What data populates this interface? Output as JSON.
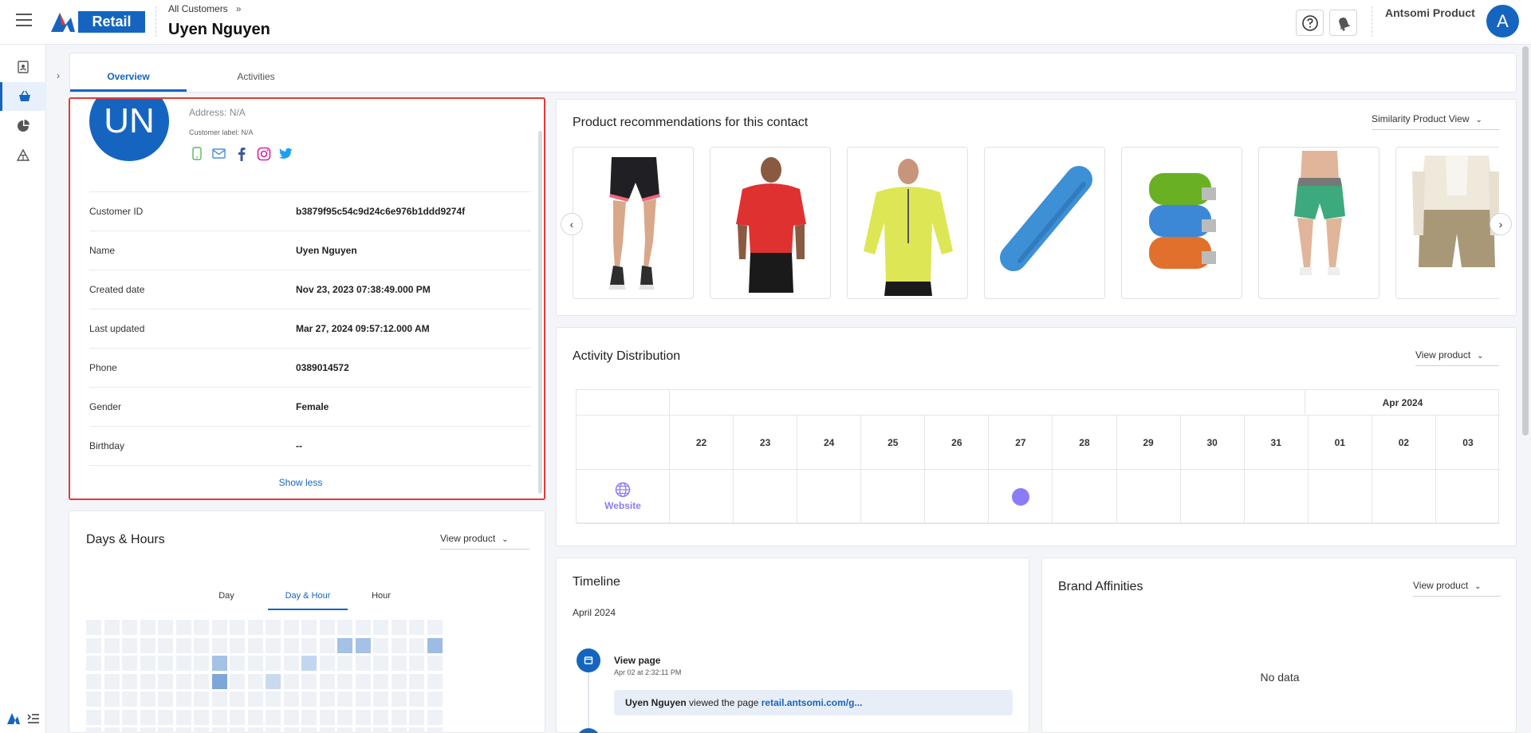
{
  "header": {
    "brand": "Retail",
    "breadcrumb": "All Customers",
    "breadcrumb_sep": "»",
    "title": "Uyen Nguyen",
    "org": "Antsomi Product",
    "user_initial": "A"
  },
  "tabs": [
    {
      "label": "Overview"
    },
    {
      "label": "Activities"
    }
  ],
  "profile": {
    "initials": "UN",
    "address": "Address: N/A",
    "customer_label": "Customer label: N/A",
    "rows": [
      {
        "key": "Customer ID",
        "value": "b3879f95c54c9d24c6e976b1ddd9274f"
      },
      {
        "key": "Name",
        "value": "Uyen Nguyen"
      },
      {
        "key": "Created date",
        "value": "Nov 23, 2023 07:38:49.000 PM"
      },
      {
        "key": "Last updated",
        "value": "Mar 27, 2024 09:57:12.000 AM"
      },
      {
        "key": "Phone",
        "value": "0389014572"
      },
      {
        "key": "Gender",
        "value": "Female"
      },
      {
        "key": "Birthday",
        "value": "--"
      }
    ],
    "show_less": "Show less"
  },
  "recs": {
    "title": "Product recommendations for this contact",
    "dropdown": "Similarity Product View"
  },
  "activity": {
    "title": "Activity Distribution",
    "dropdown": "View product",
    "month": "Apr 2024",
    "days": [
      "22",
      "23",
      "24",
      "25",
      "26",
      "27",
      "28",
      "29",
      "30",
      "31",
      "01",
      "02",
      "03"
    ],
    "channel": "Website"
  },
  "dayshours": {
    "title": "Days & Hours",
    "dropdown": "View product",
    "segments": [
      "Day",
      "Day & Hour",
      "Hour"
    ]
  },
  "timeline": {
    "title": "Timeline",
    "month": "April 2024",
    "event": "View page",
    "event_time": "Apr 02 at 2:32:11 PM",
    "actor": "Uyen Nguyen",
    "action": " viewed the page ",
    "link": "retail.antsomi.com/g..."
  },
  "brand": {
    "title": "Brand Affinities",
    "dropdown": "View product",
    "empty": "No data"
  },
  "colors": {
    "accent": "#1565c0",
    "highlight_border": "#e53935",
    "activity_dot": "#8b7cf6"
  }
}
